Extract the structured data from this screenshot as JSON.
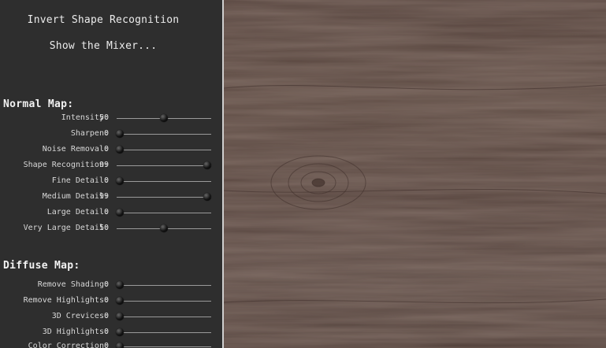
{
  "top": {
    "invert_label": "Invert Shape Recognition",
    "mixer_label": "Show the Mixer..."
  },
  "normal_map": {
    "title": "Normal Map:",
    "sliders": [
      {
        "label": "Intensity:",
        "value": 50
      },
      {
        "label": "Sharpen:",
        "value": 0
      },
      {
        "label": "Noise Removal:",
        "value": 0
      },
      {
        "label": "Shape Recognition:",
        "value": 99
      },
      {
        "label": "Fine Detail:",
        "value": 0
      },
      {
        "label": "Medium Detail:",
        "value": 99
      },
      {
        "label": "Large Detail:",
        "value": 0
      },
      {
        "label": "Very Large Detail:",
        "value": 50
      }
    ]
  },
  "diffuse_map": {
    "title": "Diffuse Map:",
    "sliders": [
      {
        "label": "Remove Shading:",
        "value": 0
      },
      {
        "label": "Remove Highlights:",
        "value": 0
      },
      {
        "label": "3D Crevices:",
        "value": 0
      },
      {
        "label": "3D Highlights:",
        "value": 0
      },
      {
        "label": "Color Correction:",
        "value": 0
      }
    ]
  },
  "slider_max": 100,
  "colors": {
    "panel_bg": "#2e2e2e",
    "preview_wood": "#4f3d36",
    "divider": "#cfcfcf"
  }
}
